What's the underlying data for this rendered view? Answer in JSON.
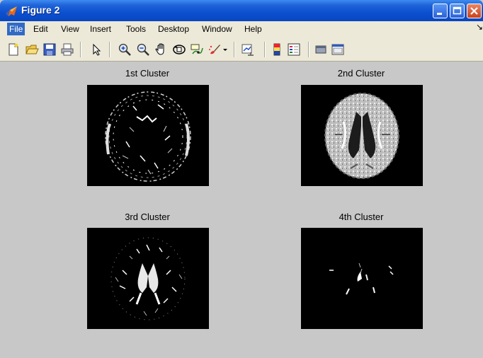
{
  "window": {
    "title": "Figure 2"
  },
  "menu": [
    {
      "label": "File",
      "active": true
    },
    {
      "label": "Edit"
    },
    {
      "label": "View"
    },
    {
      "label": "Insert"
    },
    {
      "label": "Tools"
    },
    {
      "label": "Desktop"
    },
    {
      "label": "Window"
    },
    {
      "label": "Help"
    }
  ],
  "toolbar": [
    "new-figure-icon",
    "open-file-icon",
    "save-icon",
    "print-icon",
    "edit-plot-arrow-icon",
    "zoom-in-icon",
    "zoom-out-icon",
    "pan-hand-icon",
    "rotate-3d-icon",
    "data-cursor-icon",
    "brush-icon",
    "link-plot-icon",
    "insert-colorbar-icon",
    "insert-legend-icon",
    "hide-plot-tools-icon",
    "show-plot-tools-icon"
  ],
  "figure": {
    "background": "#c8c8c8",
    "subplots": [
      {
        "title": "1st Cluster"
      },
      {
        "title": "2nd Cluster"
      },
      {
        "title": "3rd Cluster"
      },
      {
        "title": "4th Cluster"
      }
    ]
  }
}
